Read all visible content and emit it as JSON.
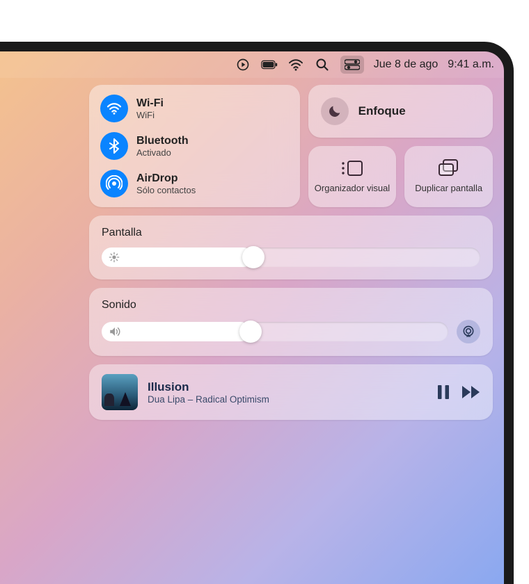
{
  "menubar": {
    "date": "Jue 8 de ago",
    "time": "9:41 a.m."
  },
  "connectivity": {
    "wifi": {
      "title": "Wi-Fi",
      "status": "WiFi"
    },
    "bluetooth": {
      "title": "Bluetooth",
      "status": "Activado"
    },
    "airdrop": {
      "title": "AirDrop",
      "status": "Sólo contactos"
    }
  },
  "focus": {
    "title": "Enfoque"
  },
  "stage_manager": {
    "label": "Organizador visual"
  },
  "screen_mirror": {
    "label": "Duplicar pantalla"
  },
  "brightness": {
    "title": "Pantalla",
    "value_pct": 40
  },
  "volume": {
    "title": "Sonido",
    "value_pct": 43
  },
  "now_playing": {
    "track": "Illusion",
    "artist_album": "Dua Lipa – Radical Optimism"
  },
  "colors": {
    "accent_blue": "#0a84ff"
  }
}
